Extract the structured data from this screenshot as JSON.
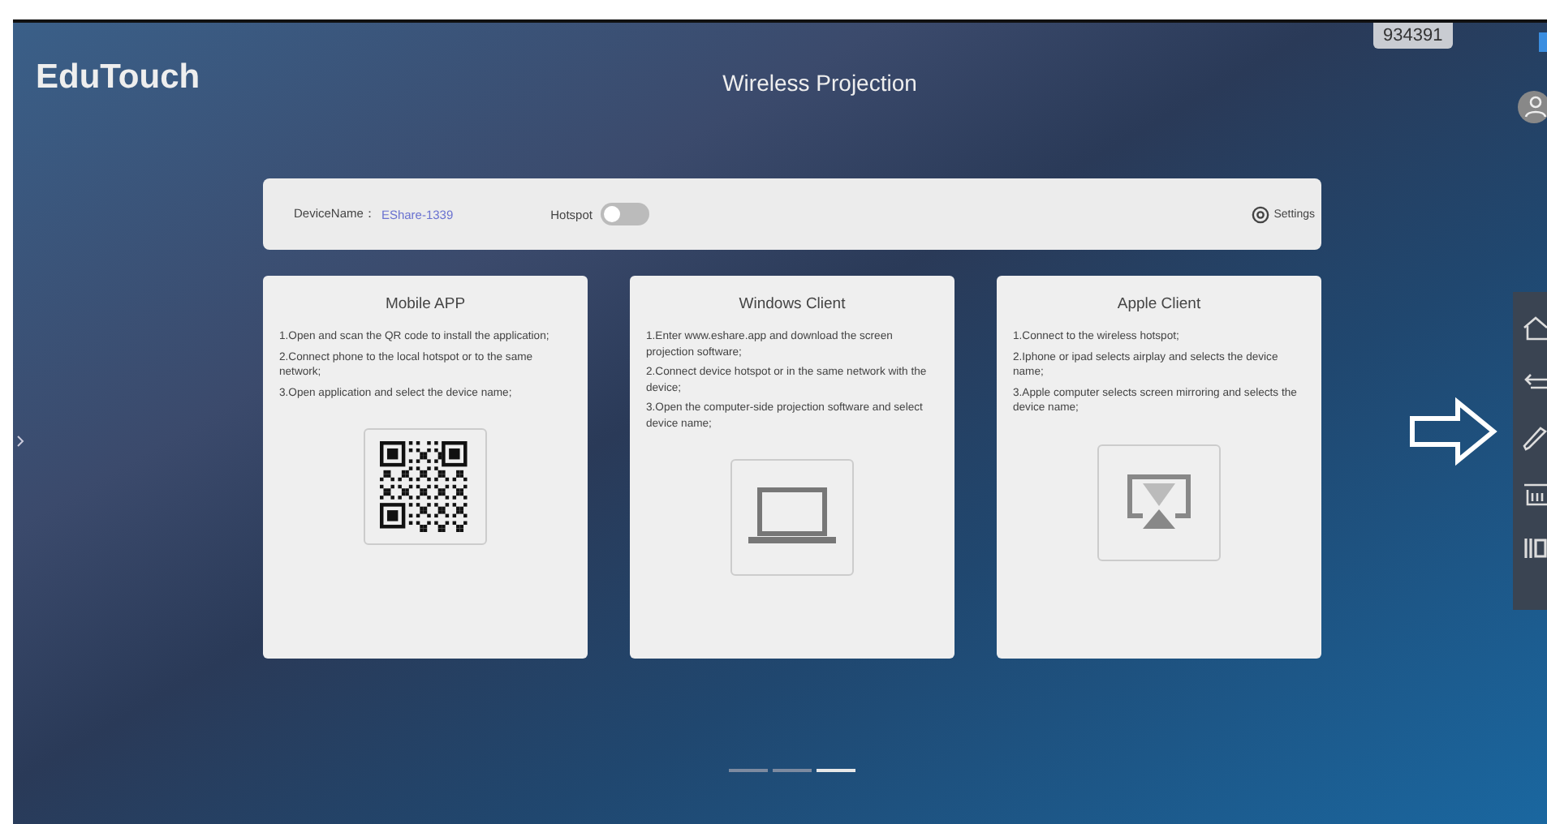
{
  "header": {
    "logo": "EduTouch",
    "title": "Wireless Projection",
    "code_badge": "934391"
  },
  "device_bar": {
    "device_label": "DeviceName：",
    "device_name": "EShare-1339",
    "hotspot_label": "Hotspot",
    "hotspot_on": false,
    "settings_label": "Settings"
  },
  "cards": [
    {
      "kind": "qr",
      "title": "Mobile APP",
      "steps": [
        "1.Open and scan the QR code to install the application;",
        "2.Connect phone to the local hotspot or to the same network;",
        "3.Open application and select the device name;"
      ]
    },
    {
      "kind": "laptop",
      "title": "Windows Client",
      "steps": [
        "1.Enter www.eshare.app and download the screen projection software;",
        "2.Connect device hotspot or in the same network with the device;",
        "3.Open the computer-side projection software and select device name;"
      ]
    },
    {
      "kind": "airplay",
      "title": "Apple Client",
      "steps": [
        "1.Connect to the wireless hotspot;",
        "2.Iphone or ipad selects airplay and selects the device name;",
        "3.Apple computer selects screen mirroring and selects the device name;"
      ]
    }
  ],
  "pager": [
    {
      "selected": false
    },
    {
      "selected": false
    },
    {
      "selected": true
    }
  ]
}
